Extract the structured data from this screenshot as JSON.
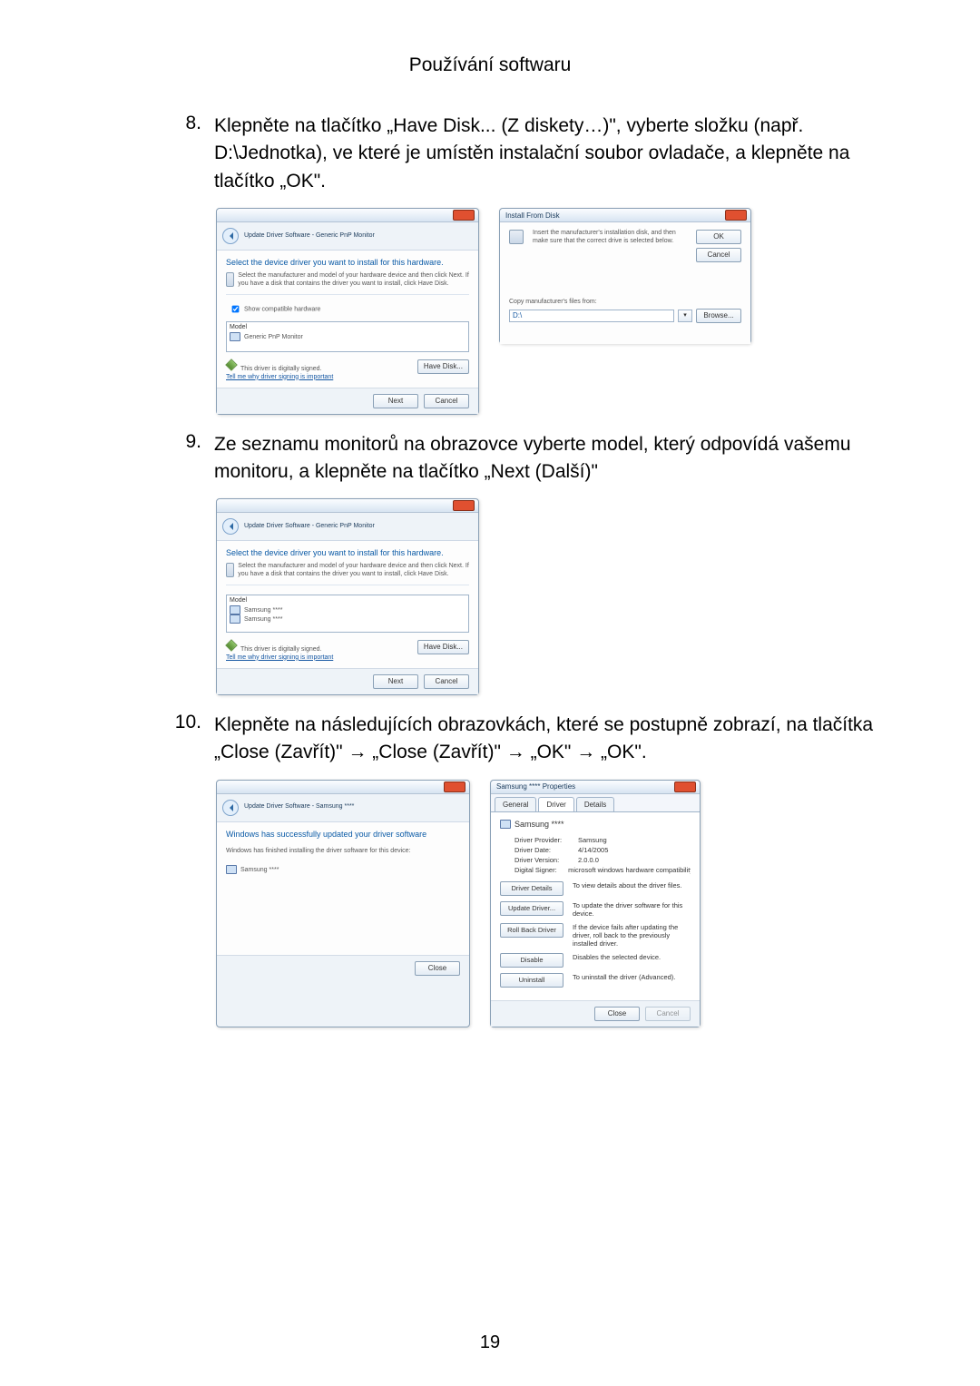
{
  "page_title": "Používání softwaru",
  "page_number": "19",
  "step8": {
    "num": "8.",
    "text": "Klepněte na tlačítko „Have Disk... (Z diskety…)\", vyberte složku (např. D:\\Jednotka), ve které je umístěn instalační soubor ovladače, a klepněte na tlačítko „OK\"."
  },
  "step9": {
    "num": "9.",
    "text": "Ze seznamu monitorů na obrazovce vyberte model, který odpovídá vašemu monitoru, a klepněte na tlačítko „Next (Další)\""
  },
  "step10": {
    "num": "10.",
    "text": "Klepněte na následujících obrazovkách, které se postupně zobrazí, na tlačítka „Close (Zavřít)\" → „Close (Zavřít)\" → „OK\" → „OK\"."
  },
  "wizard_a": {
    "crumb": "Update Driver Software - Generic PnP Monitor",
    "heading": "Select the device driver you want to install for this hardware.",
    "desc": "Select the manufacturer and model of your hardware device and then click Next. If you have a disk that contains the driver you want to install, click Have Disk.",
    "show_compat": "Show compatible hardware",
    "model_label": "Model",
    "model_item": "Generic PnP Monitor",
    "signed": "This driver is digitally signed.",
    "tell_me": "Tell me why driver signing is important",
    "have_disk": "Have Disk...",
    "next": "Next",
    "cancel": "Cancel"
  },
  "install_disk": {
    "title": "Install From Disk",
    "desc": "Insert the manufacturer's installation disk, and then make sure that the correct drive is selected below.",
    "ok": "OK",
    "cancel": "Cancel",
    "copy_from": "Copy manufacturer's files from:",
    "path": "D:\\",
    "browse": "Browse..."
  },
  "wizard_b": {
    "crumb": "Update Driver Software - Generic PnP Monitor",
    "heading": "Select the device driver you want to install for this hardware.",
    "desc": "Select the manufacturer and model of your hardware device and then click Next. If you have a disk that contains the driver you want to install, click Have Disk.",
    "model_label": "Model",
    "model_item1": "Samsung ****",
    "model_item2": "Samsung ****",
    "signed": "This driver is digitally signed.",
    "tell_me": "Tell me why driver signing is important",
    "have_disk": "Have Disk...",
    "next": "Next",
    "cancel": "Cancel"
  },
  "wizard_c": {
    "crumb": "Update Driver Software - Samsung ****",
    "heading": "Windows has successfully updated your driver software",
    "finished": "Windows has finished installing the driver software for this device:",
    "device": "Samsung ****",
    "close": "Close"
  },
  "props": {
    "title": "Samsung **** Properties",
    "tab_general": "General",
    "tab_driver": "Driver",
    "tab_details": "Details",
    "device_name": "Samsung ****",
    "rows": {
      "provider_l": "Driver Provider:",
      "provider_v": "Samsung",
      "date_l": "Driver Date:",
      "date_v": "4/14/2005",
      "version_l": "Driver Version:",
      "version_v": "2.0.0.0",
      "signer_l": "Digital Signer:",
      "signer_v": "microsoft windows hardware compatibility publis"
    },
    "btn_details": "Driver Details",
    "btn_details_d": "To view details about the driver files.",
    "btn_update": "Update Driver...",
    "btn_update_d": "To update the driver software for this device.",
    "btn_rollback": "Roll Back Driver",
    "btn_rollback_d": "If the device fails after updating the driver, roll back to the previously installed driver.",
    "btn_disable": "Disable",
    "btn_disable_d": "Disables the selected device.",
    "btn_uninstall": "Uninstall",
    "btn_uninstall_d": "To uninstall the driver (Advanced).",
    "close": "Close",
    "cancel": "Cancel"
  }
}
